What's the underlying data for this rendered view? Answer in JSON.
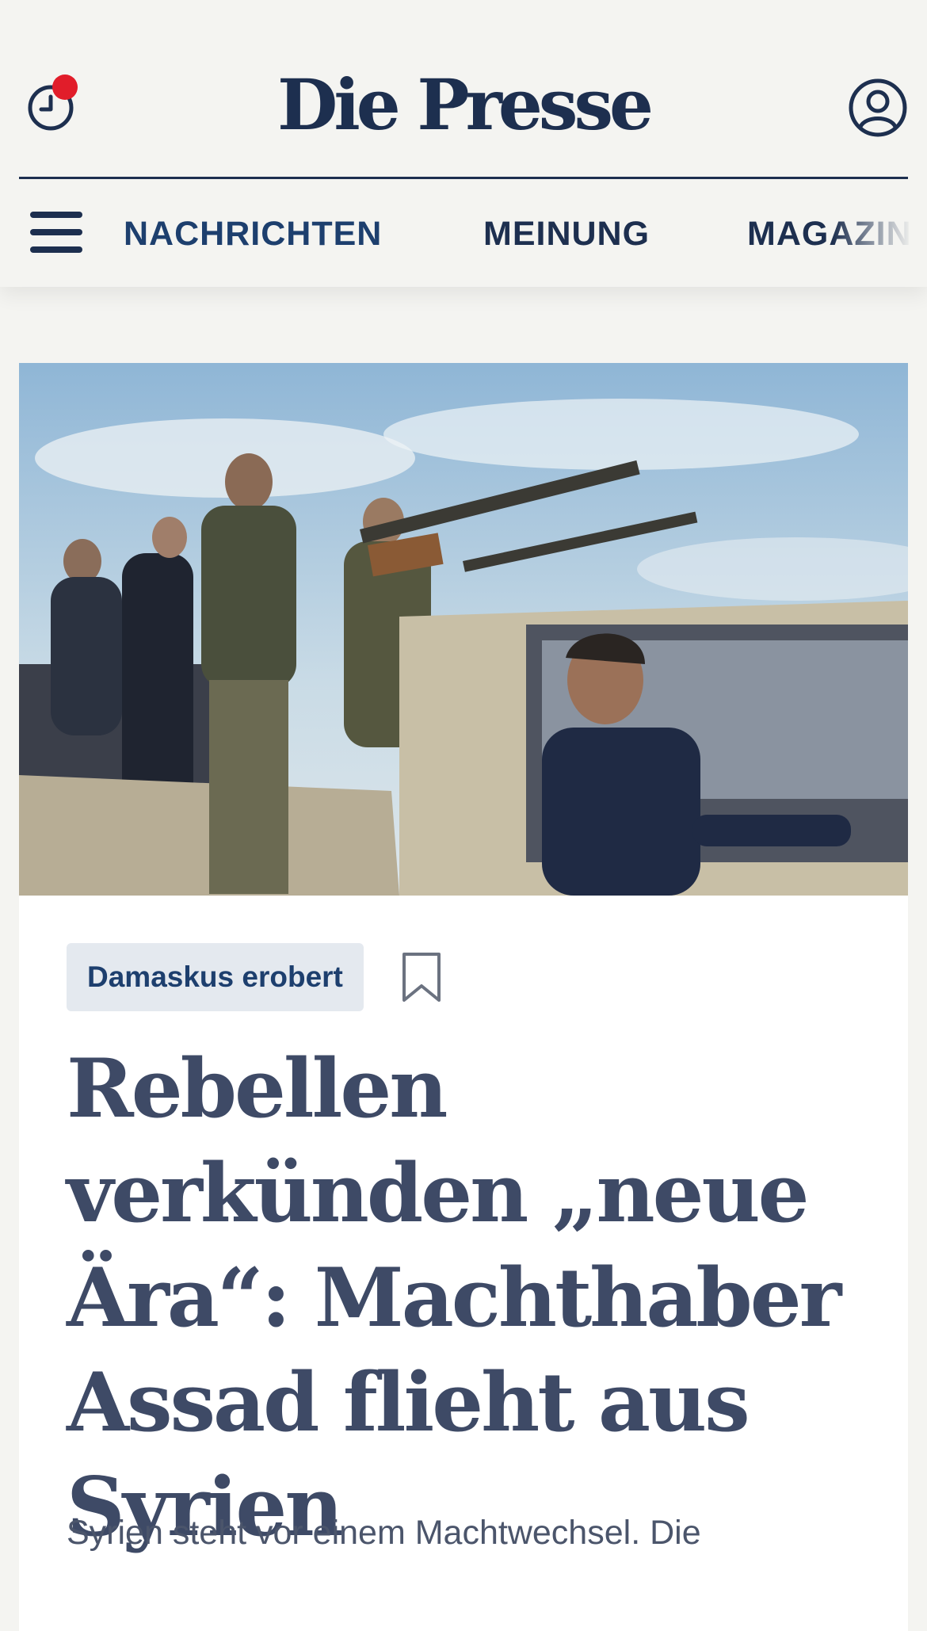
{
  "header": {
    "logo": "Die Presse"
  },
  "nav": {
    "items": [
      {
        "label": "NACHRICHTEN",
        "active": true,
        "color": "#1d3f6e"
      },
      {
        "label": "MEINUNG",
        "active": false,
        "color": "#1d2f4f"
      },
      {
        "label": "MAGAZIN",
        "active": false,
        "color": "#1d2f4f"
      }
    ]
  },
  "article": {
    "tag": "Damaskus erobert",
    "headline": "Rebellen verkünden „neue Ära“: Machthaber Assad flieht aus Syrien",
    "lead": "Syrien steht vor einem Machtwechsel. Die"
  },
  "icons": {
    "history": "clock-icon",
    "notification": "notification-dot",
    "account": "user-icon",
    "menu": "hamburger-menu-icon",
    "bookmark": "bookmark-icon"
  },
  "colors": {
    "brand_navy": "#1d2f4f",
    "link_blue": "#1d3f6e",
    "notification_red": "#e11d2a",
    "page_background": "#f4f4f1",
    "tag_background": "#e4e9ef",
    "headline_text": "#3e4a66"
  }
}
